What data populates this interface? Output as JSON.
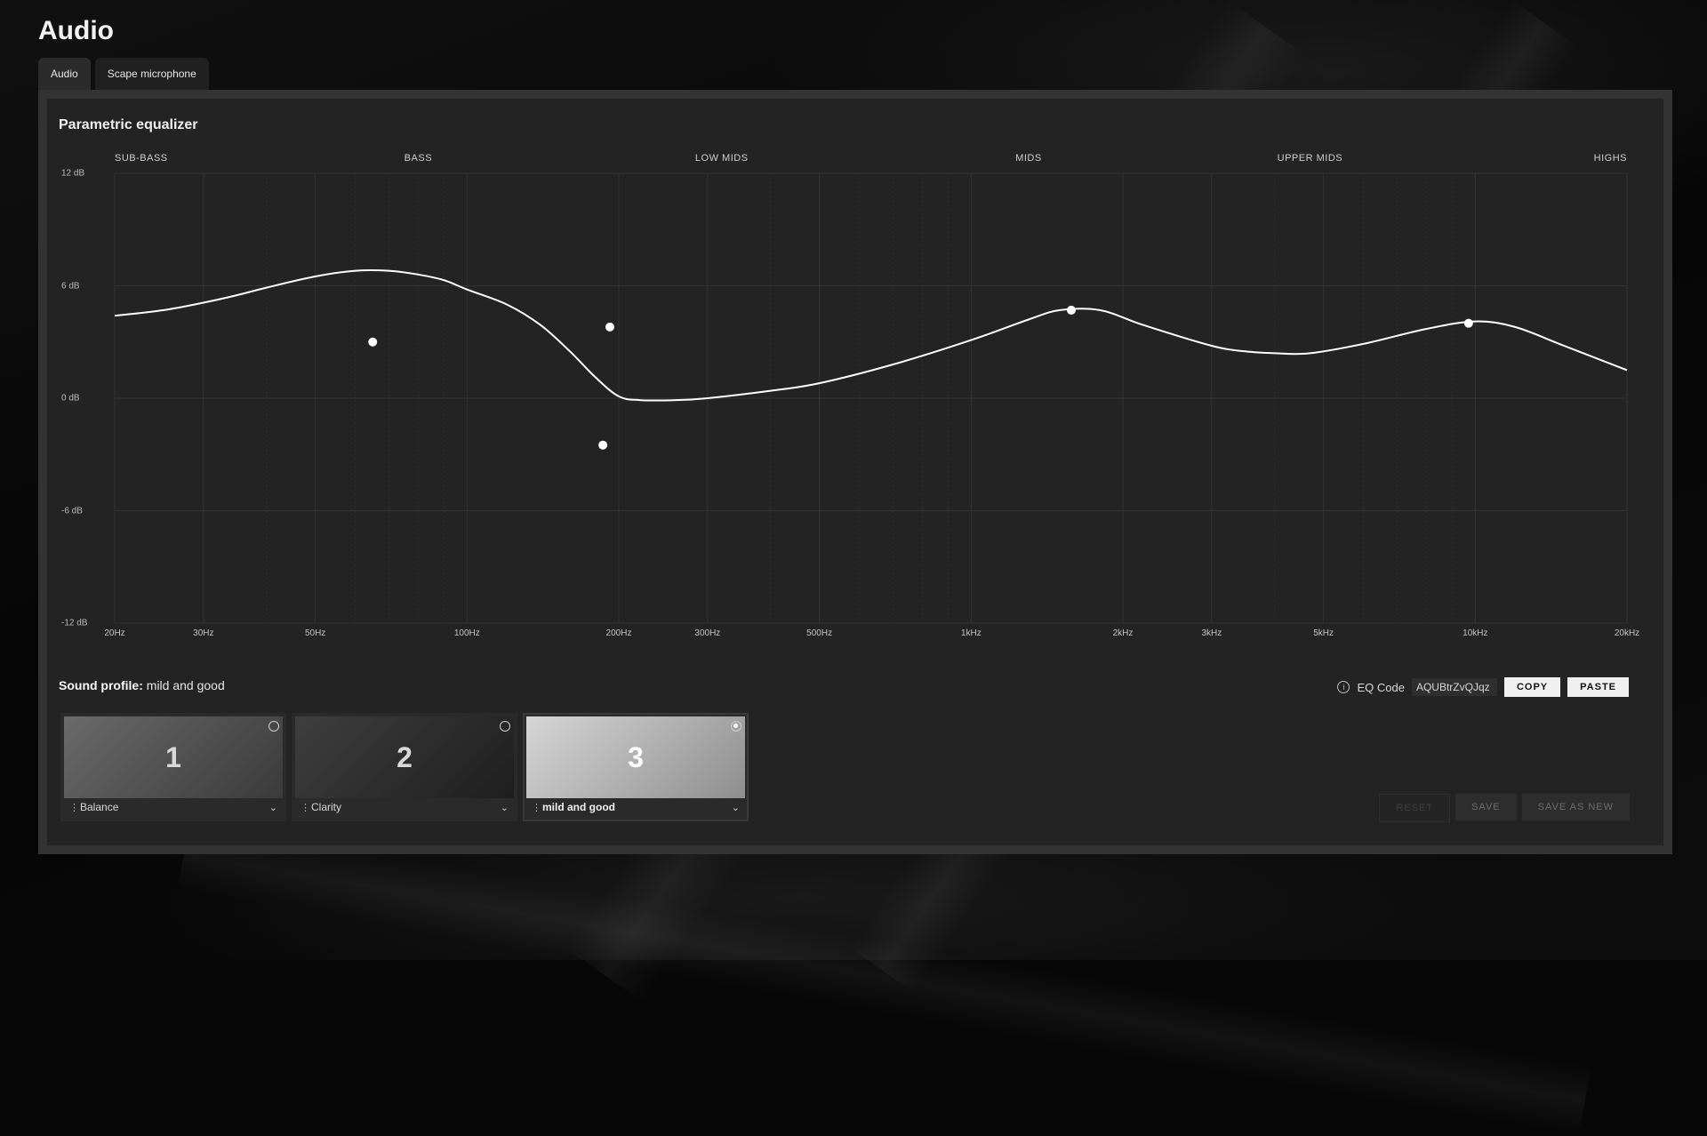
{
  "app": {
    "title": "Audio"
  },
  "tabs": [
    {
      "label": "Audio",
      "active": true
    },
    {
      "label": "Scape microphone",
      "active": false
    }
  ],
  "equalizer": {
    "title": "Parametric equalizer",
    "bands": [
      {
        "label": "SUB-BASS",
        "freq": 25
      },
      {
        "label": "BASS",
        "freq": 80
      },
      {
        "label": "LOW MIDS",
        "freq": 320
      },
      {
        "label": "MIDS",
        "freq": 1300
      },
      {
        "label": "UPPER MIDS",
        "freq": 4700
      },
      {
        "label": "HIGHS",
        "freq": 20000
      }
    ],
    "db_ticks": [
      {
        "label": "12 dB",
        "value": 12
      },
      {
        "label": "6 dB",
        "value": 6
      },
      {
        "label": "0 dB",
        "value": 0
      },
      {
        "label": "-6 dB",
        "value": -6
      },
      {
        "label": "-12 dB",
        "value": -12
      }
    ],
    "freq_ticks": [
      {
        "label": "20Hz",
        "value": 20
      },
      {
        "label": "30Hz",
        "value": 30
      },
      {
        "label": "50Hz",
        "value": 50
      },
      {
        "label": "100Hz",
        "value": 100
      },
      {
        "label": "200Hz",
        "value": 200
      },
      {
        "label": "300Hz",
        "value": 300
      },
      {
        "label": "500Hz",
        "value": 500
      },
      {
        "label": "1kHz",
        "value": 1000
      },
      {
        "label": "2kHz",
        "value": 2000
      },
      {
        "label": "3kHz",
        "value": 3000
      },
      {
        "label": "5kHz",
        "value": 5000
      },
      {
        "label": "10kHz",
        "value": 10000
      },
      {
        "label": "20kHz",
        "value": 20000
      }
    ],
    "freq_range": [
      20,
      20000
    ],
    "db_range": [
      -12,
      12
    ],
    "curve": [
      [
        20,
        4.4
      ],
      [
        25,
        4.7
      ],
      [
        30,
        5.1
      ],
      [
        35,
        5.5
      ],
      [
        40,
        5.9
      ],
      [
        50,
        6.5
      ],
      [
        60,
        6.8
      ],
      [
        70,
        6.8
      ],
      [
        80,
        6.6
      ],
      [
        90,
        6.3
      ],
      [
        100,
        5.8
      ],
      [
        120,
        5.0
      ],
      [
        140,
        3.9
      ],
      [
        160,
        2.5
      ],
      [
        180,
        1.1
      ],
      [
        200,
        0.1
      ],
      [
        220,
        -0.1
      ],
      [
        260,
        -0.1
      ],
      [
        300,
        0.0
      ],
      [
        400,
        0.4
      ],
      [
        500,
        0.8
      ],
      [
        700,
        1.8
      ],
      [
        1000,
        3.1
      ],
      [
        1300,
        4.2
      ],
      [
        1500,
        4.7
      ],
      [
        1800,
        4.7
      ],
      [
        2200,
        3.9
      ],
      [
        3000,
        2.8
      ],
      [
        3500,
        2.5
      ],
      [
        4000,
        2.4
      ],
      [
        4700,
        2.4
      ],
      [
        6000,
        2.9
      ],
      [
        8000,
        3.7
      ],
      [
        10000,
        4.1
      ],
      [
        12000,
        3.8
      ],
      [
        15000,
        2.8
      ],
      [
        20000,
        1.5
      ]
    ],
    "nodes": [
      {
        "freq": 65,
        "gain": 3.0
      },
      {
        "freq": 186,
        "gain": -2.5
      },
      {
        "freq": 192,
        "gain": 3.8
      },
      {
        "freq": 1580,
        "gain": 4.7
      },
      {
        "freq": 9700,
        "gain": 4.0
      }
    ],
    "colors": {
      "grid": "#333333",
      "curve": "#ffffff",
      "node": "#ffffff"
    }
  },
  "sound_profile": {
    "label": "Sound profile:",
    "value": "mild and good"
  },
  "eq_code": {
    "label": "EQ Code",
    "value": "AQUBtrZvQJqz",
    "copy_label": "COPY",
    "paste_label": "PASTE"
  },
  "slots": [
    {
      "number": "1",
      "name": "Balance",
      "selected": false,
      "gradient": [
        "#6a6a6a",
        "#3a3a3a"
      ]
    },
    {
      "number": "2",
      "name": "Clarity",
      "selected": false,
      "gradient": [
        "#3e3e3e",
        "#1e1e1e"
      ]
    },
    {
      "number": "3",
      "name": "mild and good",
      "selected": true,
      "gradient": [
        "#d6d6d6",
        "#8e8e8e"
      ]
    }
  ],
  "actions": {
    "reset_label": "RESET",
    "save_label": "SAVE",
    "save_as_new_label": "SAVE AS NEW"
  }
}
